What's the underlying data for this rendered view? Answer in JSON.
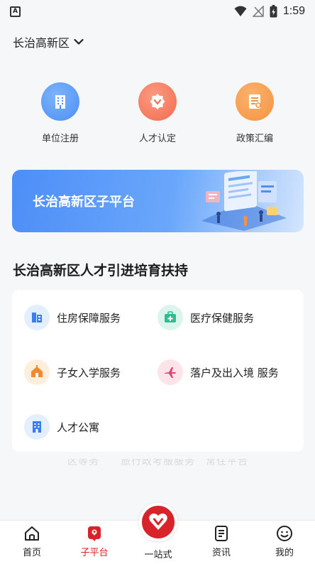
{
  "status_bar": {
    "app_icon_letter": "A",
    "time": "1:59"
  },
  "location": {
    "label": "长治高新区",
    "icon": "chevron-down-icon"
  },
  "quick_actions": [
    {
      "label": "单位注册",
      "icon": "building-icon",
      "color": "#4a8ff5"
    },
    {
      "label": "人才认定",
      "icon": "badge-icon",
      "color": "#f26b4f"
    },
    {
      "label": "政策汇编",
      "icon": "document-icon",
      "color": "#f5923e"
    }
  ],
  "banner": {
    "title": "长治高新区子平台"
  },
  "section": {
    "title": "长治高新区人才引进培育扶持"
  },
  "services": [
    {
      "label": "住房保障服务",
      "icon": "housing-icon",
      "color": "#3b7ef0"
    },
    {
      "label": "医疗保健服务",
      "icon": "medical-kit-icon",
      "color": "#2dbd8e"
    },
    {
      "label": "子女入学服务",
      "icon": "school-icon",
      "color": "#f08a2c"
    },
    {
      "label": "落户及出入境 服务",
      "icon": "airplane-icon",
      "color": "#e83f6f"
    },
    {
      "label": "人才公寓",
      "icon": "apartment-icon",
      "color": "#3b7ef0"
    }
  ],
  "ghost_text": "区等务　　旅行政考服服务　常住平台",
  "tab_bar": {
    "items": [
      {
        "label": "首页",
        "icon": "home-icon"
      },
      {
        "label": "子平台",
        "icon": "location-pin-icon",
        "active": true
      },
      {
        "label": "一站式",
        "icon": "heart-icon"
      },
      {
        "label": "资讯",
        "icon": "news-icon"
      },
      {
        "label": "我的",
        "icon": "smiley-icon"
      }
    ],
    "active_color": "#d8232a"
  }
}
